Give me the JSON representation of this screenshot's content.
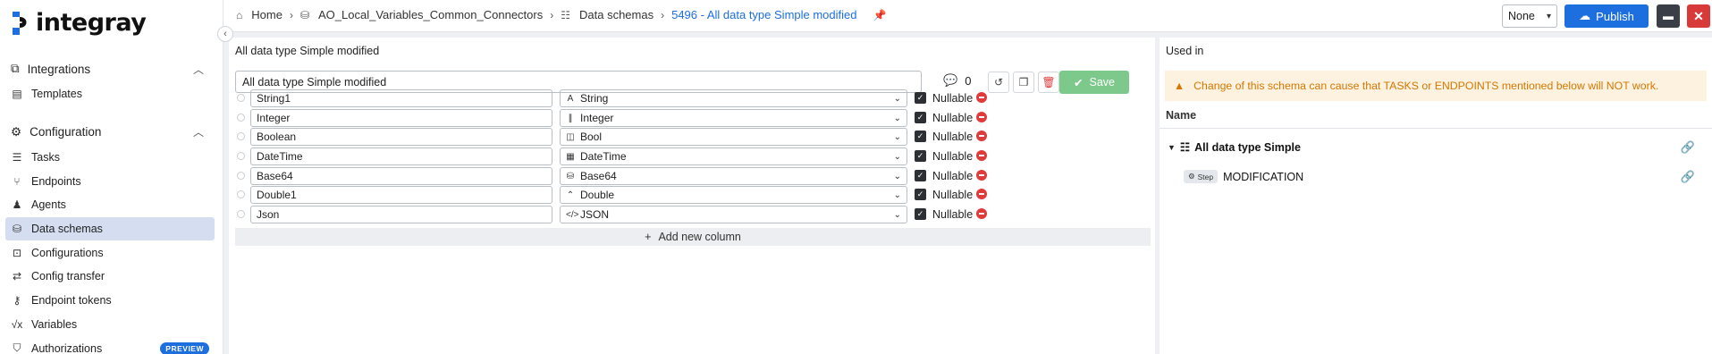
{
  "app": {
    "logo_text": "integray"
  },
  "sidebar": {
    "groups": [
      {
        "label": "Integrations",
        "items": [
          {
            "label": "Templates"
          }
        ]
      },
      {
        "label": "Configuration",
        "items": [
          {
            "label": "Tasks"
          },
          {
            "label": "Endpoints"
          },
          {
            "label": "Agents"
          },
          {
            "label": "Data schemas"
          },
          {
            "label": "Configurations"
          },
          {
            "label": "Config transfer"
          },
          {
            "label": "Endpoint tokens"
          },
          {
            "label": "Variables"
          },
          {
            "label": "Authorizations",
            "badge": "PREVIEW"
          }
        ]
      }
    ],
    "active_item": "Data schemas"
  },
  "breadcrumb": [
    {
      "label": "Home"
    },
    {
      "label": "AO_Local_Variables_Common_Connectors"
    },
    {
      "label": "Data schemas"
    },
    {
      "label": "5496 - All data type Simple modified"
    }
  ],
  "header": {
    "stage_select": "None",
    "publish_label": "Publish"
  },
  "editor": {
    "title": "All data type Simple modified",
    "name_value": "All data type Simple modified",
    "comment_count": "0",
    "save_label": "Save",
    "nullable_label": "Nullable",
    "add_column_label": "Add new column",
    "columns": [
      {
        "name": "String1",
        "type": "String",
        "type_icon": "text-icon"
      },
      {
        "name": "Integer",
        "type": "Integer",
        "type_icon": "integer-icon"
      },
      {
        "name": "Boolean",
        "type": "Bool",
        "type_icon": "bool-icon"
      },
      {
        "name": "DateTime",
        "type": "DateTime",
        "type_icon": "calendar-icon"
      },
      {
        "name": "Base64",
        "type": "Base64",
        "type_icon": "database-icon"
      },
      {
        "name": "Double1",
        "type": "Double",
        "type_icon": "double-icon"
      },
      {
        "name": "Json",
        "type": "JSON",
        "type_icon": "code-icon"
      }
    ]
  },
  "used_in": {
    "title": "Used in",
    "warning": "Change of this schema can cause that TASKS or ENDPOINTS mentioned below will NOT work.",
    "column_header": "Name",
    "items": [
      {
        "label": "All data type Simple",
        "children": [
          {
            "badge": "Step",
            "label": "MODIFICATION"
          }
        ]
      }
    ]
  },
  "colors": {
    "accent": "#1d6fe0",
    "save": "#7cc98b",
    "danger": "#e03a3a",
    "warning": "#d47800"
  }
}
